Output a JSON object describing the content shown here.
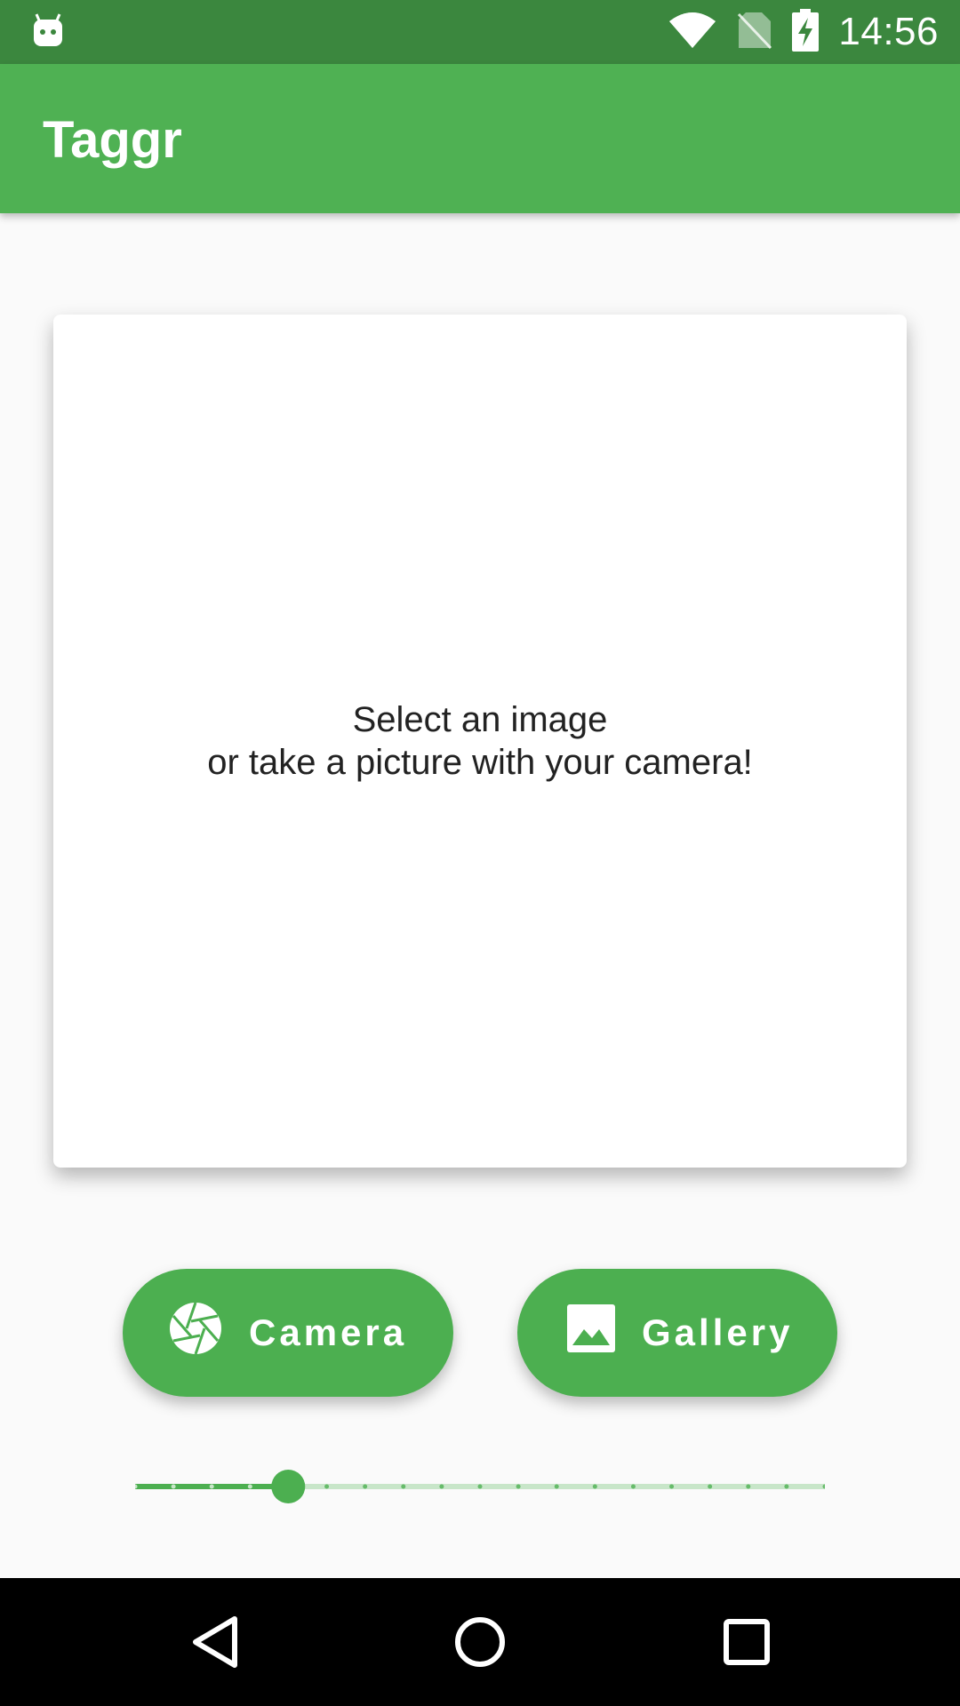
{
  "status_bar": {
    "time": "14:56",
    "icons": [
      "android-icon",
      "wifi-icon",
      "no-sim-icon",
      "battery-charging-icon"
    ]
  },
  "app_bar": {
    "title": "Taggr"
  },
  "image_card": {
    "line1": "Select an image",
    "line2": "or take a picture with your camera!"
  },
  "buttons": {
    "camera_label": "Camera",
    "gallery_label": "Gallery"
  },
  "slider": {
    "value_fraction": 0.222,
    "steps": 18,
    "active_color": "#4caf50",
    "inactive_color": "#c8e6c9"
  },
  "nav_bar": {
    "icons": [
      "back-icon",
      "home-icon",
      "recents-icon"
    ]
  },
  "colors": {
    "status_bar": "#3b873e",
    "app_bar": "#4fb153",
    "accent": "#4caf50"
  }
}
